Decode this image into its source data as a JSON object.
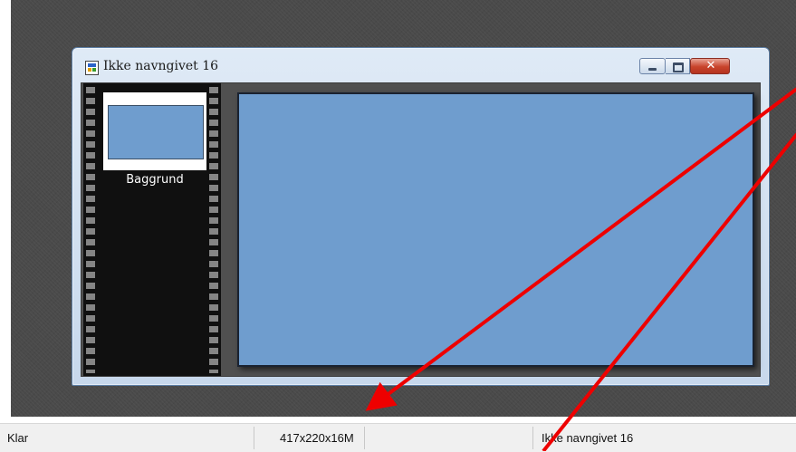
{
  "document_window": {
    "title": "Ikke navngivet 16",
    "icon": "document-icon",
    "controls": {
      "minimize_icon": "minimize-icon",
      "maximize_icon": "maximize-icon",
      "close_icon": "close-icon",
      "close_glyph": "✕"
    },
    "filmstrip": {
      "thumbnail_label": "Baggrund"
    },
    "canvas_color": "#6f9dce"
  },
  "status_bar": {
    "ready_text": "Klar",
    "image_info": "417x220x16M",
    "document_name": "Ikke navngivet 16"
  },
  "annotation": {
    "arrow_color": "#ee0000",
    "arrow_count": 2
  }
}
